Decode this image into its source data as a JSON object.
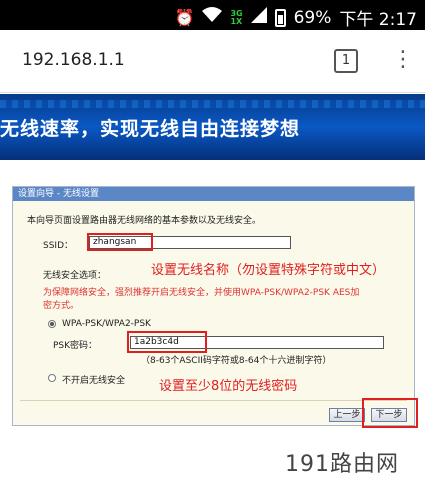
{
  "status": {
    "battery": "69%",
    "time": "下午 2:17",
    "network": "3G",
    "network2": "1X"
  },
  "browser": {
    "url": "192.168.1.1",
    "tab_count": "1"
  },
  "banner": {
    "text": "无线速率，实现无线自由连接梦想"
  },
  "wizard": {
    "title": "设置向导 - 无线设置",
    "intro": "本向导页面设置路由器无线网络的基本参数以及无线安全。",
    "ssid_label": "SSID：",
    "ssid_value": "zhangsan",
    "security_label": "无线安全选项：",
    "security_note_1": "为保障网络安全，强烈推荐开启无线安全，并使用WPA-PSK/WPA2-PSK AES加",
    "security_note_2": "密方式。",
    "wpa_label": "WPA-PSK/WPA2-PSK",
    "psk_label": "PSK密码：",
    "psk_value": "1a2b3c4d",
    "psk_hint": "（8-63个ASCII码字符或8-64个十六进制字符）",
    "no_security_label": "不开启无线安全",
    "prev_button": "上一步",
    "next_button": "下一步"
  },
  "annotations": {
    "ssid_note": "设置无线名称（勿设置特殊字符或中文）",
    "psk_note": "设置至少8位的无线密码"
  },
  "watermark": "191路由网"
}
